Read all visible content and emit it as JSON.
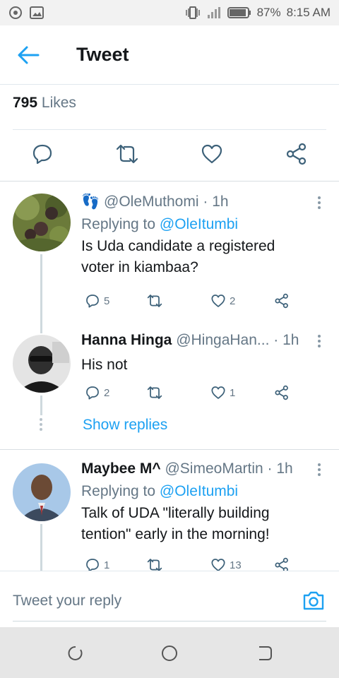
{
  "status_bar": {
    "battery": "87%",
    "time": "8:15 AM"
  },
  "header": {
    "title": "Tweet"
  },
  "likes": {
    "count": "795",
    "label": "Likes"
  },
  "tweets": [
    {
      "emoji": "👣",
      "name": "",
      "handle": "@OleMuthomi",
      "time": "· 1h",
      "replying_label": "Replying to",
      "replying_handle": "@OleItumbi",
      "text": "Is Uda candidate a registered voter in kiambaa?",
      "replies": "5",
      "retweets": "",
      "likes": "2"
    },
    {
      "name": "Hanna Hinga",
      "handle": "@HingaHan...",
      "time": "· 1h",
      "text": "His not",
      "replies": "2",
      "retweets": "",
      "likes": "1",
      "show_replies": "Show replies"
    },
    {
      "name": "Maybee M^",
      "handle": "@SimeoMartin",
      "time": "· 1h",
      "replying_label": "Replying to",
      "replying_handle": "@OleItumbi",
      "text": "Talk of UDA \"literally building tention\" early in the morning!",
      "replies": "1",
      "retweets": "",
      "likes": "13"
    }
  ],
  "reply_bar": {
    "placeholder": "Tweet your reply"
  },
  "colors": {
    "accent": "#1da1f2",
    "muted": "#657786",
    "icon": "#3d6179"
  }
}
